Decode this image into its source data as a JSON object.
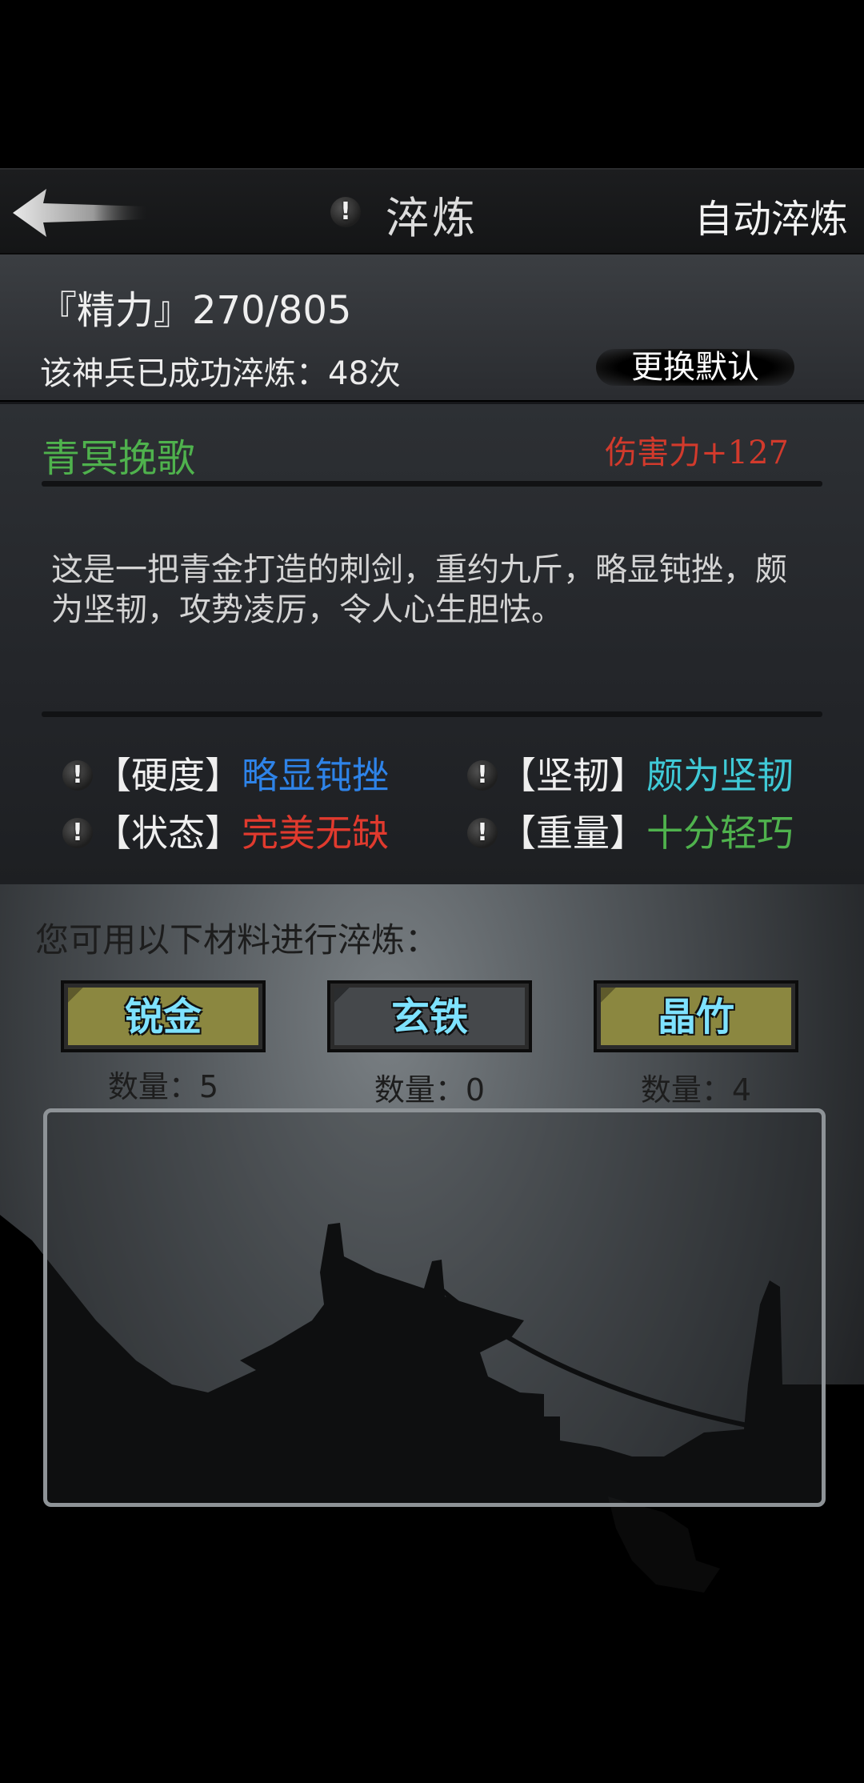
{
  "header": {
    "title": "淬炼",
    "auto_label": "自动淬炼",
    "warn_glyph": "!"
  },
  "info": {
    "energy": "『精力』270/805",
    "refined_count": "该神兵已成功淬炼：48次",
    "change_default": "更换默认"
  },
  "weapon": {
    "name": "青冥挽歌",
    "damage": "伤害力+127",
    "description": "这是一把青金打造的刺剑，重约九斤，略显钝挫，颇为坚韧，攻势凌厉，令人心生胆怯。",
    "attributes": [
      {
        "label": "【硬度】",
        "value": "略显钝挫",
        "color": "#2e83e8"
      },
      {
        "label": "【坚韧】",
        "value": "颇为坚韧",
        "color": "#3fc9d6"
      },
      {
        "label": "【状态】",
        "value": "完美无缺",
        "color": "#e03a2e"
      },
      {
        "label": "【重量】",
        "value": "十分轻巧",
        "color": "#4fb24d"
      }
    ]
  },
  "materials": {
    "prompt": "您可用以下材料进行淬炼：",
    "items": [
      {
        "name": "锐金",
        "count": "数量：5"
      },
      {
        "name": "玄铁",
        "count": "数量：0"
      },
      {
        "name": "晶竹",
        "count": "数量：4"
      }
    ]
  }
}
